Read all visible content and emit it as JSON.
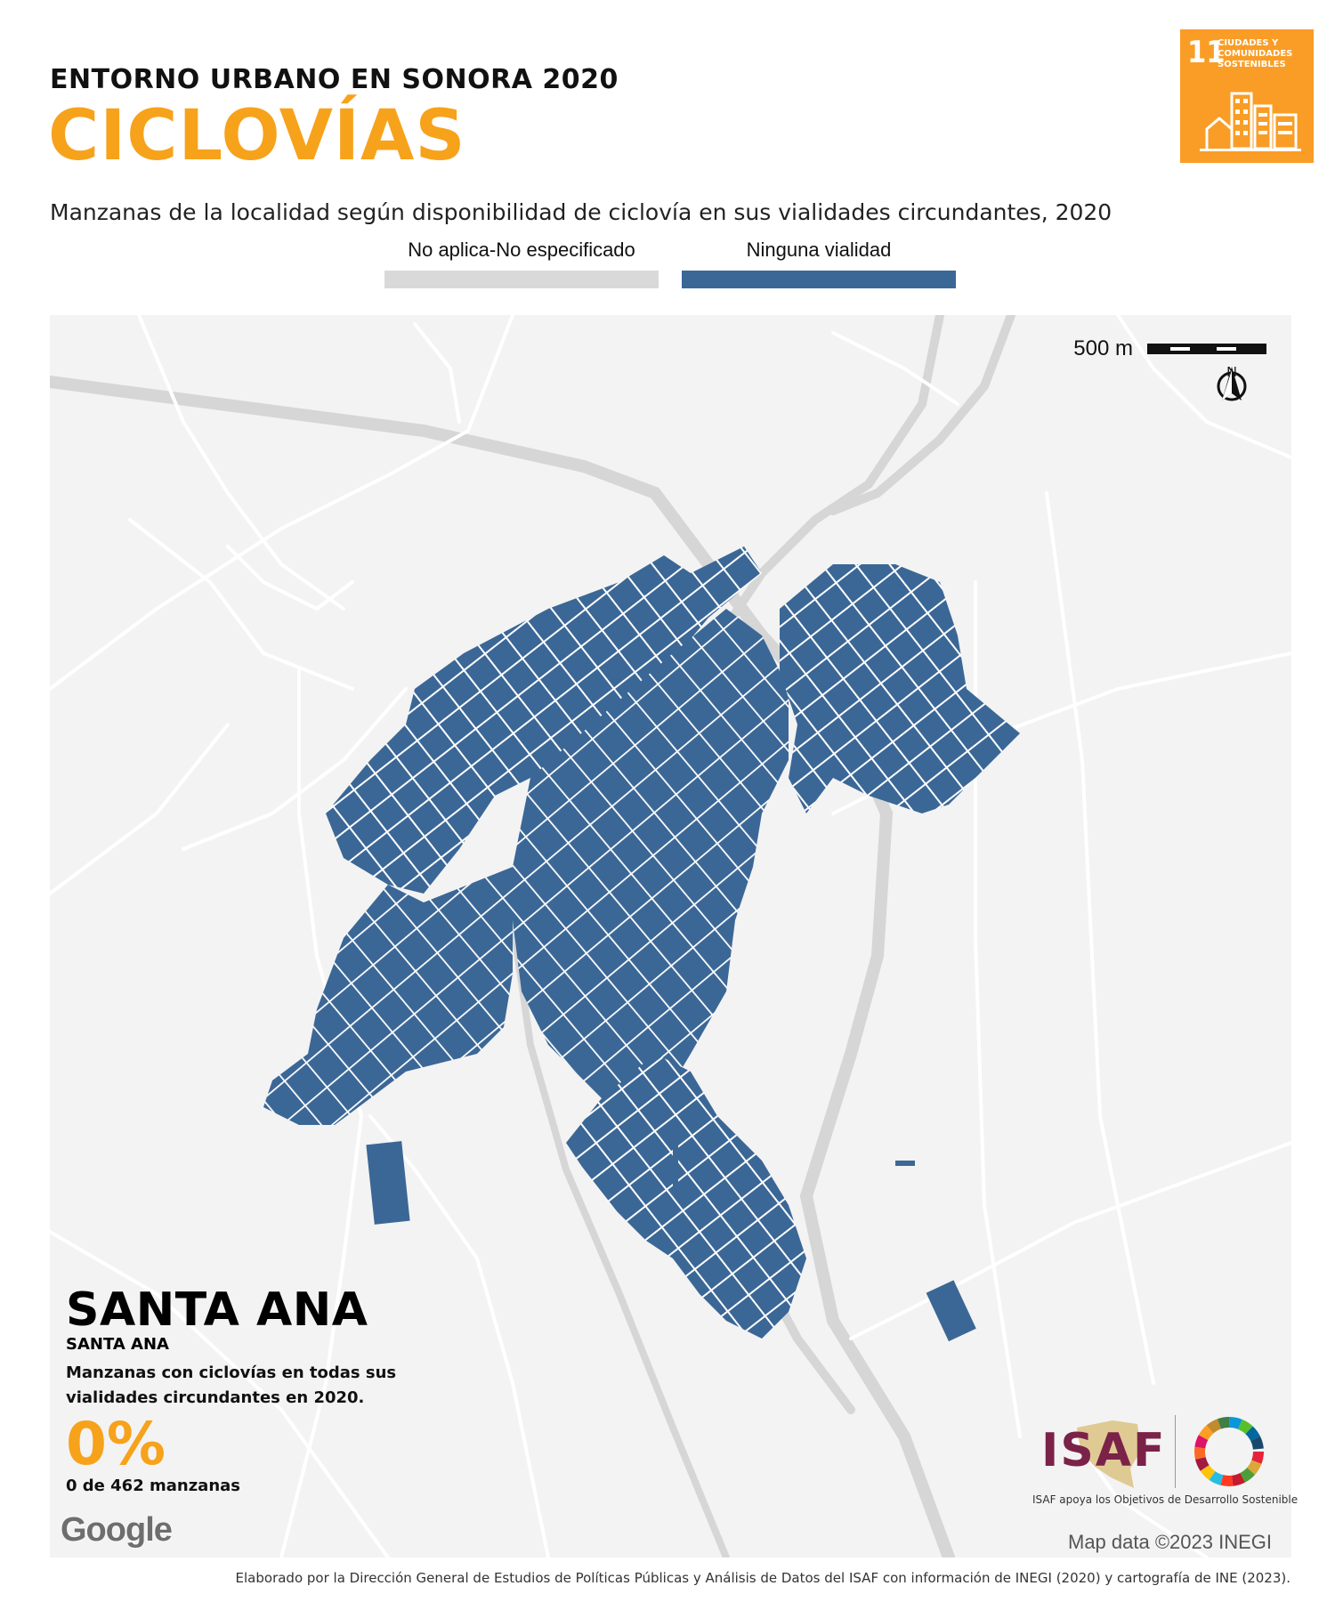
{
  "header": {
    "kicker": "ENTORNO URBANO EN SONORA 2020",
    "title": "CICLOVÍAS",
    "subtitle": "Manzanas de la localidad según disponibilidad de ciclovía en sus vialidades circundantes, 2020"
  },
  "sdg_badge": {
    "number": "11",
    "text": "CIUDADES Y COMUNIDADES SOSTENIBLES",
    "color": "#f99d26"
  },
  "legend": [
    {
      "label": "No aplica-No especificado",
      "color": "#d9d9d9"
    },
    {
      "label": "Ninguna vialidad",
      "color": "#3b6796"
    }
  ],
  "map": {
    "scale_label": "500 m",
    "north_label": "N",
    "block_color": "#3b6796",
    "background": "#f3f3f3",
    "road_color": "#ffffff",
    "highway_color": "#d6d6d6"
  },
  "location": {
    "title": "SANTA ANA",
    "subtitle": "SANTA ANA",
    "description": "Manzanas con ciclovías en todas sus vialidades circundantes en 2020.",
    "percent": "0%",
    "count": "0 de 462 manzanas"
  },
  "attribution": {
    "google": "Google",
    "map_data": "Map data ©2023 INEGI"
  },
  "isaf": {
    "name": "ISAF",
    "caption": "ISAF apoya los Objetivos de Desarrollo Sostenible"
  },
  "footer": "Elaborado por la Dirección General de Estudios de Políticas Públicas y Análisis de Datos del ISAF con información de INEGI (2020) y cartografía de INE (2023)."
}
